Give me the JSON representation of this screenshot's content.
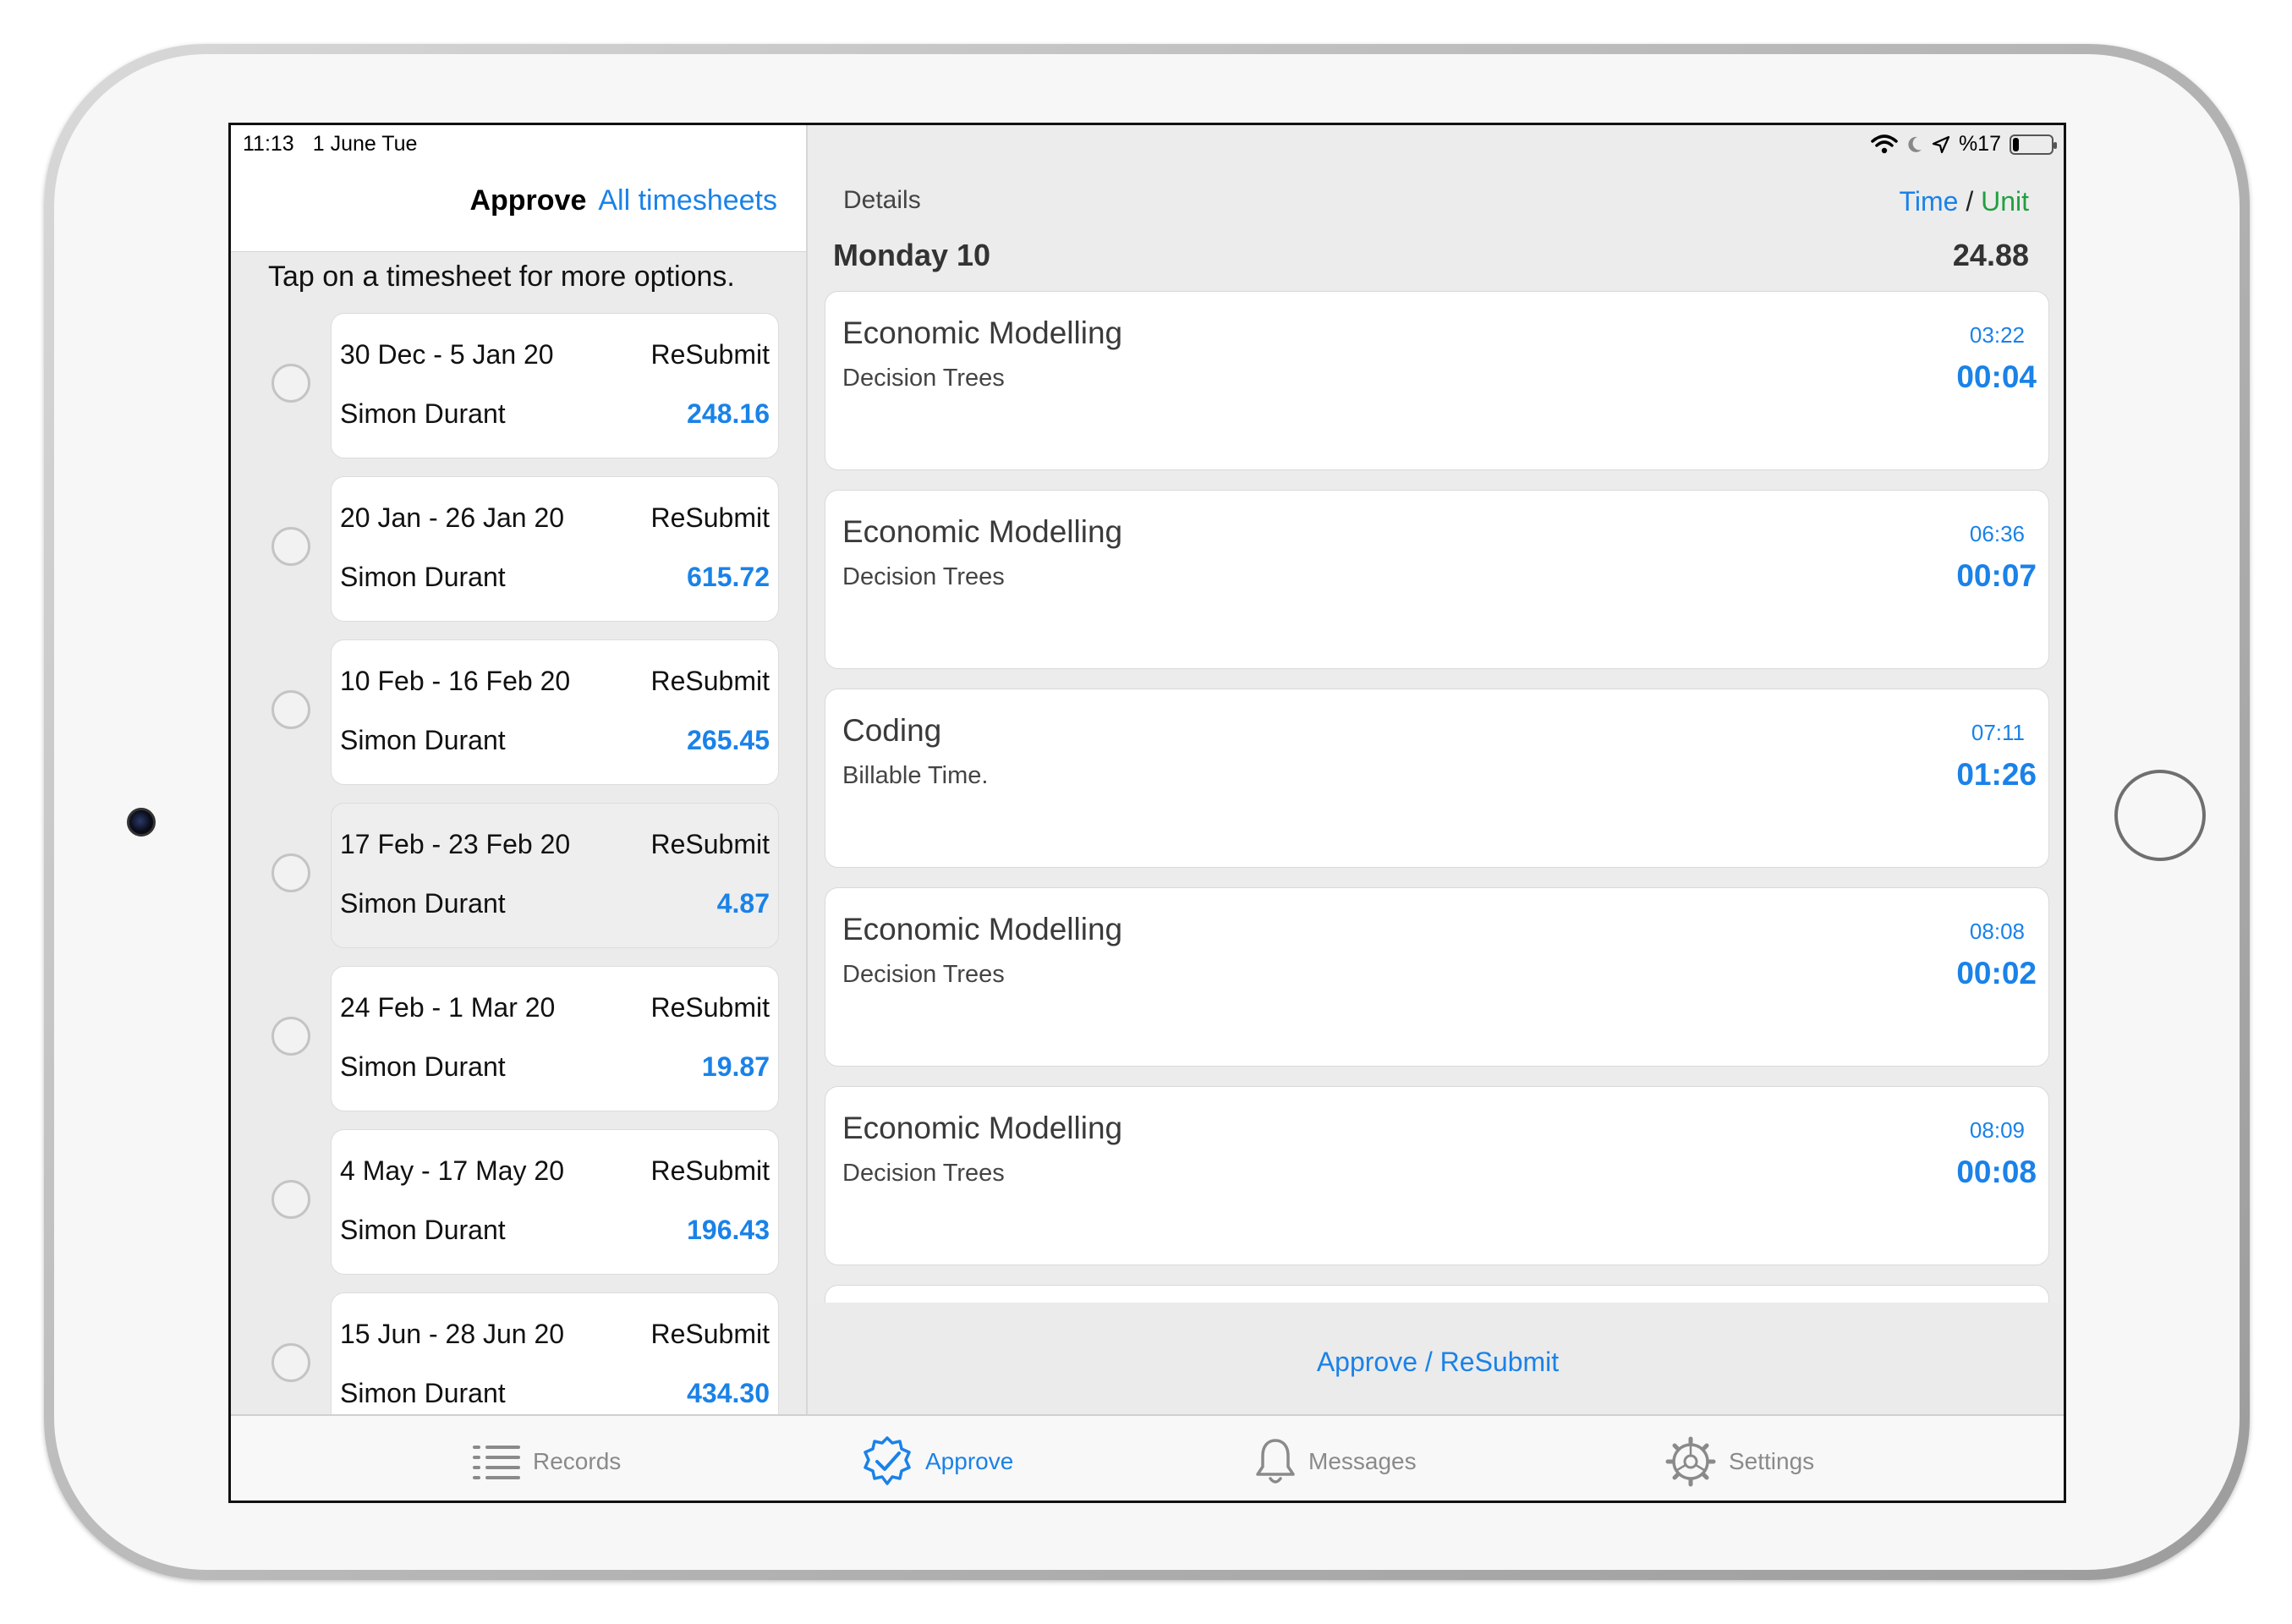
{
  "status_bar": {
    "time": "11:13",
    "date": "1 June Tue",
    "battery_text": "%17",
    "battery_level": 0.17
  },
  "left": {
    "title": "Approve",
    "link": "All timesheets",
    "hint": "Tap on a timesheet for more options.",
    "timesheets": [
      {
        "range": "30 Dec - 5 Jan 20",
        "status": "ReSubmit",
        "name": "Simon Durant",
        "total": "248.16"
      },
      {
        "range": "20 Jan - 26 Jan 20",
        "status": "ReSubmit",
        "name": "Simon Durant",
        "total": "615.72"
      },
      {
        "range": "10 Feb - 16 Feb 20",
        "status": "ReSubmit",
        "name": "Simon Durant",
        "total": "265.45"
      },
      {
        "range": "17 Feb - 23 Feb 20",
        "status": "ReSubmit",
        "name": "Simon Durant",
        "total": "4.87"
      },
      {
        "range": "24 Feb - 1 Mar 20",
        "status": "ReSubmit",
        "name": "Simon Durant",
        "total": "19.87"
      },
      {
        "range": "4 May - 17 May 20",
        "status": "ReSubmit",
        "name": "Simon Durant",
        "total": "196.43"
      },
      {
        "range": "15 Jun - 28 Jun 20",
        "status": "ReSubmit",
        "name": "Simon Durant",
        "total": "434.30"
      }
    ]
  },
  "right": {
    "details_label": "Details",
    "toggle_time": "Time",
    "toggle_sep": "/",
    "toggle_unit": "Unit",
    "day": "Monday 10",
    "day_total": "24.88",
    "entries": [
      {
        "title": "Economic Modelling",
        "subtitle": "Decision Trees",
        "clock": "03:22",
        "duration": "00:04"
      },
      {
        "title": "Economic Modelling",
        "subtitle": "Decision Trees",
        "clock": "06:36",
        "duration": "00:07"
      },
      {
        "title": "Coding",
        "subtitle": "Billable Time.",
        "clock": "07:11",
        "duration": "01:26"
      },
      {
        "title": "Economic Modelling",
        "subtitle": "Decision Trees",
        "clock": "08:08",
        "duration": "00:02"
      },
      {
        "title": "Economic Modelling",
        "subtitle": "Decision Trees",
        "clock": "08:09",
        "duration": "00:08"
      }
    ],
    "action": "Approve / ReSubmit"
  },
  "tabs": [
    {
      "label": "Records",
      "icon": "list-icon"
    },
    {
      "label": "Approve",
      "icon": "check-badge-icon"
    },
    {
      "label": "Messages",
      "icon": "bell-icon"
    },
    {
      "label": "Settings",
      "icon": "gear-icon"
    }
  ],
  "colors": {
    "accent": "#1a82e8",
    "unit_green": "#20a040",
    "inactive_tab": "#8a8a8a"
  }
}
